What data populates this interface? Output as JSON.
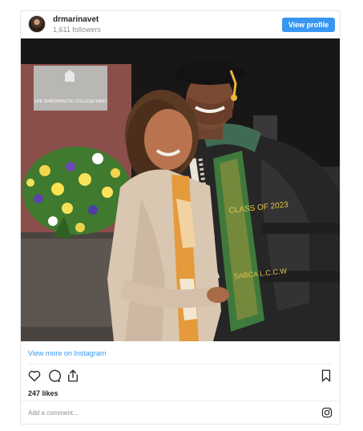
{
  "header": {
    "username": "drmarinavet",
    "followers": "1,611 followers",
    "view_profile_label": "View profile"
  },
  "photo": {
    "backdrop_sign": "LIFE CHIROPRACTIC COLLEGE WEST",
    "stole_text_left": "CLASS OF 2023",
    "stole_text_right": "SABCA L.C.C.W"
  },
  "footer": {
    "view_more_label": "View more on Instagram",
    "likes": "247 likes",
    "comment_placeholder": "Add a comment..."
  },
  "icons": [
    "heart-icon",
    "comment-icon",
    "share-icon",
    "bookmark-icon",
    "instagram-icon"
  ],
  "colors": {
    "accent": "#3897f0",
    "text": "#262626",
    "muted": "#8e8e8e",
    "border": "#e6e6e6"
  }
}
